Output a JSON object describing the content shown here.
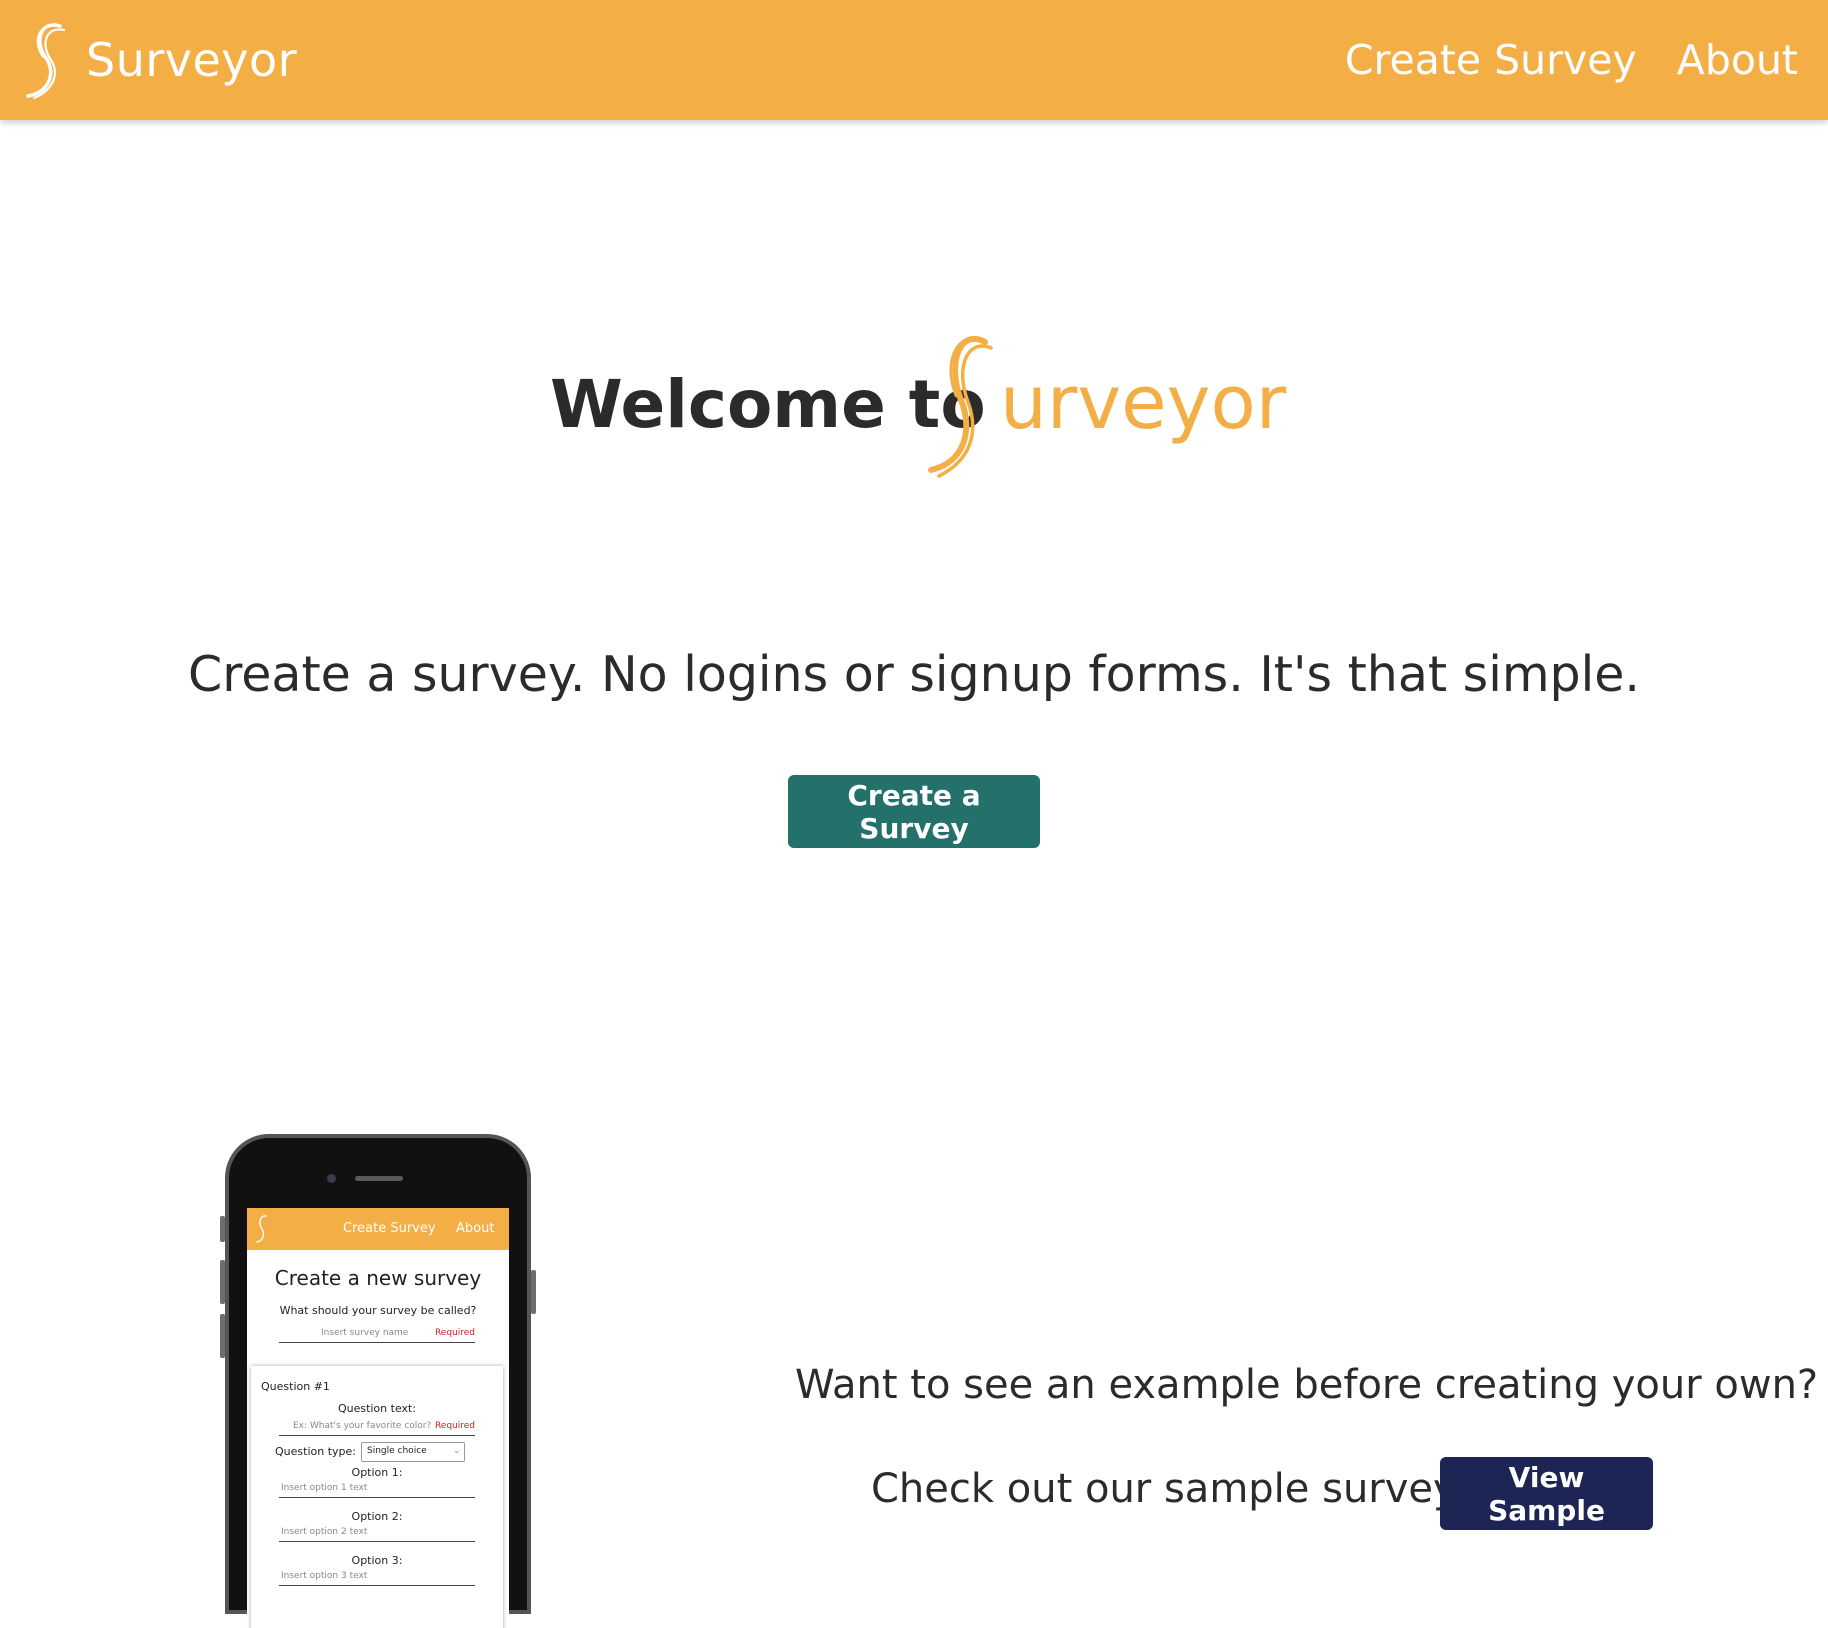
{
  "colors": {
    "brand": "#f4ae46",
    "primary_button": "#24706b",
    "sample_button": "#1c2553",
    "text": "#2b2b2b"
  },
  "nav": {
    "brand": "Surveyor",
    "logo_icon": "s-swirl-logo-icon",
    "links": [
      "Create Survey",
      "About"
    ]
  },
  "hero": {
    "welcome": "Welcome to",
    "brand_suffix": "urveyor",
    "tagline": "Create a survey. No logins or signup forms. It's that simple.",
    "cta": "Create a Survey"
  },
  "phone_preview": {
    "nav_links": [
      "Create Survey",
      "About"
    ],
    "title": "Create a new survey",
    "name_prompt": "What should your survey be called?",
    "name_placeholder": "Insert survey name",
    "required": "Required",
    "question_label": "Question #1",
    "question_text_label": "Question text:",
    "question_placeholder": "Ex: What's your favorite color?",
    "question_type_label": "Question type:",
    "question_type_value": "Single choice",
    "options": [
      {
        "label": "Option 1:",
        "placeholder": "Insert option 1 text"
      },
      {
        "label": "Option 2:",
        "placeholder": "Insert option 2 text"
      },
      {
        "label": "Option 3:",
        "placeholder": "Insert option 3 text"
      }
    ]
  },
  "sample": {
    "question": "Want to see an example before creating your own?",
    "check_out": "Check out our sample survey:",
    "button": "View Sample"
  }
}
